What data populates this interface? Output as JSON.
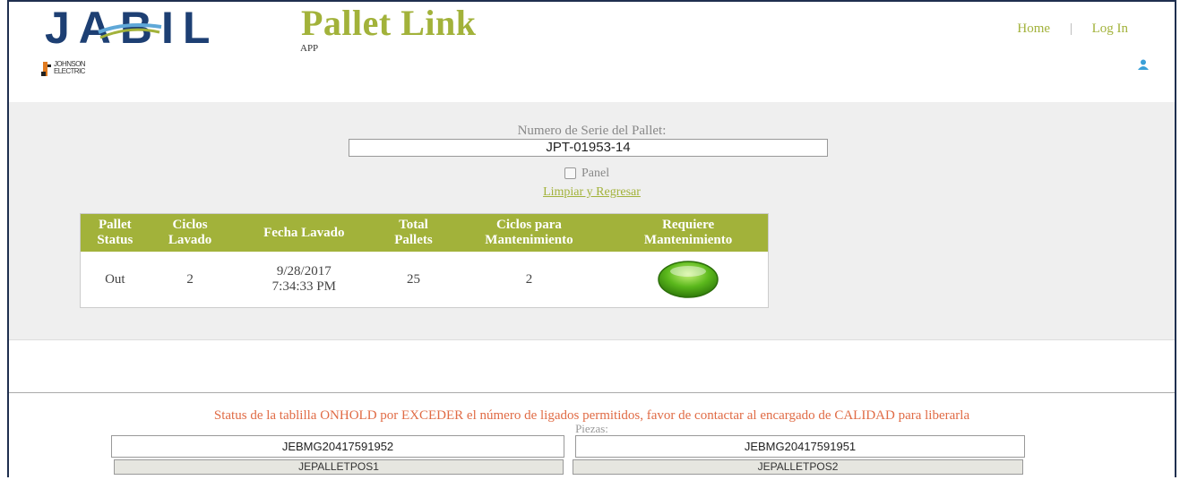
{
  "header": {
    "brand": "JABIL",
    "app_title": "Pallet Link",
    "app_subtitle": "APP",
    "customer_logo_line1": "JOHNSON",
    "customer_logo_line2": "ELECTRIC",
    "nav": {
      "home": "Home",
      "separator": "|",
      "login": "Log In"
    },
    "user_icon": "user-icon"
  },
  "form": {
    "serial_label": "Numero de Serie del Pallet:",
    "serial_value": "JPT-01953-14",
    "panel_label": "Panel",
    "panel_checked": false,
    "clear_link": "Limpiar y Regresar"
  },
  "status_table": {
    "headers": [
      [
        "Pallet",
        "Status"
      ],
      [
        "Ciclos",
        "Lavado"
      ],
      [
        "Fecha Lavado"
      ],
      [
        "Total",
        "Pallets"
      ],
      [
        "Ciclos para",
        "Mantenimiento"
      ],
      [
        "Requiere",
        "Mantenimiento"
      ]
    ],
    "row": {
      "pallet_status": "Out",
      "ciclos_lavado": "2",
      "fecha_lavado_date": "9/28/2017",
      "fecha_lavado_time": "7:34:33 PM",
      "total_pallets": "25",
      "ciclos_mantenimiento": "2",
      "requiere_mantenimiento_indicator": "green"
    }
  },
  "bottom": {
    "warning": "Status de la tablilla ONHOLD por EXCEDER el número de ligados permitidos, favor de contactar al encargado de CALIDAD para liberarla",
    "pieces_label": "Piezas:",
    "pieces": [
      {
        "value": "JEBMG20417591952",
        "position": "JEPALLETPOS1"
      },
      {
        "value": "JEBMG20417591951",
        "position": "JEPALLETPOS2"
      }
    ]
  },
  "colors": {
    "accent": "#a2b23a",
    "warning": "#e06b45",
    "brand_blue": "#1d3f73"
  }
}
